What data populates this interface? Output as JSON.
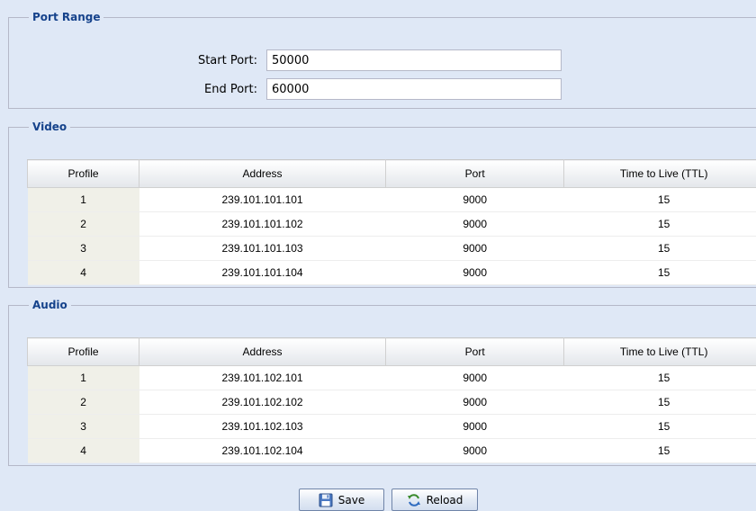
{
  "port_range": {
    "legend": "Port Range",
    "start_port_label": "Start Port:",
    "start_port_value": "50000",
    "end_port_label": "End Port:",
    "end_port_value": "60000"
  },
  "video": {
    "legend": "Video",
    "columns": [
      "Profile",
      "Address",
      "Port",
      "Time to Live (TTL)"
    ],
    "rows": [
      {
        "profile": "1",
        "address": "239.101.101.101",
        "port": "9000",
        "ttl": "15"
      },
      {
        "profile": "2",
        "address": "239.101.101.102",
        "port": "9000",
        "ttl": "15"
      },
      {
        "profile": "3",
        "address": "239.101.101.103",
        "port": "9000",
        "ttl": "15"
      },
      {
        "profile": "4",
        "address": "239.101.101.104",
        "port": "9000",
        "ttl": "15"
      }
    ]
  },
  "audio": {
    "legend": "Audio",
    "columns": [
      "Profile",
      "Address",
      "Port",
      "Time to Live (TTL)"
    ],
    "rows": [
      {
        "profile": "1",
        "address": "239.101.102.101",
        "port": "9000",
        "ttl": "15"
      },
      {
        "profile": "2",
        "address": "239.101.102.102",
        "port": "9000",
        "ttl": "15"
      },
      {
        "profile": "3",
        "address": "239.101.102.103",
        "port": "9000",
        "ttl": "15"
      },
      {
        "profile": "4",
        "address": "239.101.102.104",
        "port": "9000",
        "ttl": "15"
      }
    ]
  },
  "buttons": {
    "save_label": "Save",
    "save_icon": "floppy-disk-icon",
    "reload_label": "Reload",
    "reload_icon": "refresh-icon"
  },
  "colors": {
    "background": "#dfe8f6",
    "legend_text": "#15428b",
    "profile_cell": "#f0f0e8"
  }
}
